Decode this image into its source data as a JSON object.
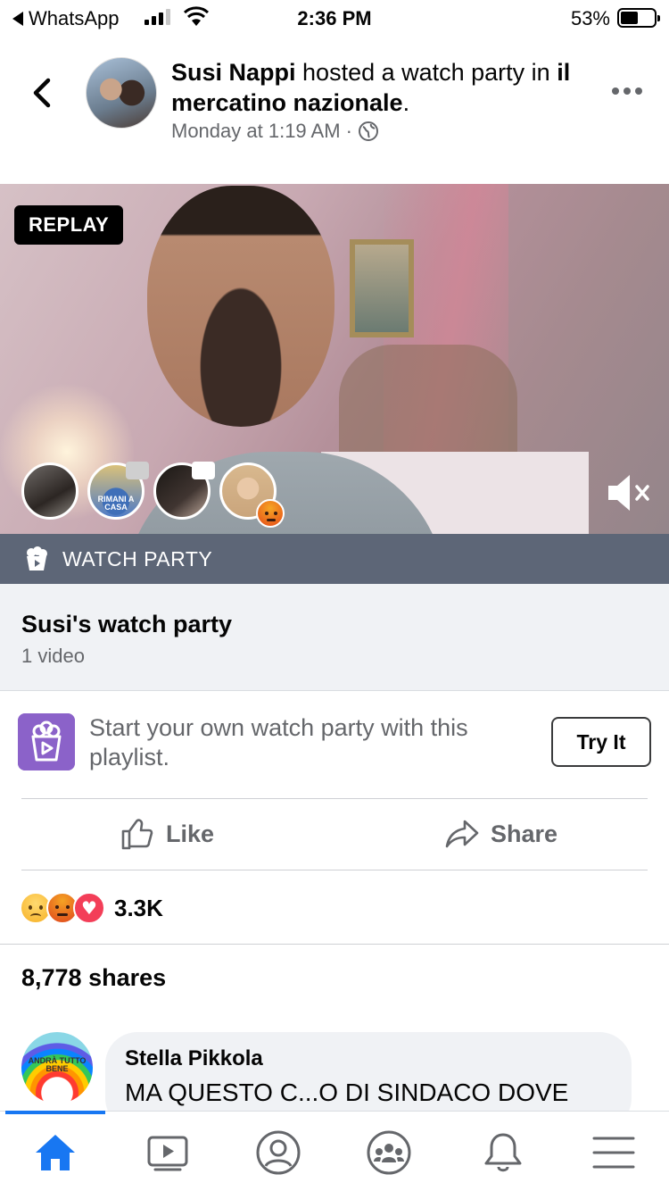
{
  "status_bar": {
    "back_app": "WhatsApp",
    "time": "2:36 PM",
    "battery_percent": "53%",
    "battery_level": 0.53,
    "signal_bars_active": 3
  },
  "post": {
    "author": "Susi Nappi",
    "action_text": " hosted a watch party in ",
    "group": "il mercatino nazionale",
    "period": ".",
    "timestamp": "Monday at 1:19 AM",
    "separator": "·",
    "privacy_icon": "globe-icon"
  },
  "video": {
    "badge": "REPLAY",
    "viewer_avatar_2_text": "RIMANI A CASA",
    "muted": true
  },
  "watch_party_bar": {
    "label": "WATCH PARTY"
  },
  "playlist": {
    "title": "Susi's watch party",
    "count": "1 video"
  },
  "promo": {
    "text": "Start your own watch party with this playlist.",
    "button": "Try It"
  },
  "actions": {
    "like": "Like",
    "share": "Share"
  },
  "reactions": {
    "types": [
      "sad",
      "angry",
      "love"
    ],
    "count": "3.3K"
  },
  "shares": "8,778 shares",
  "comment": {
    "avatar_text": "ANDRÀ TUTTO BENE",
    "author": "Stella Pikkola",
    "text": "MA QUESTO C...O DI SINDACO DOVE"
  },
  "tabbar": {
    "items": [
      "home-icon",
      "watch-icon",
      "profile-icon",
      "groups-icon",
      "notifications-icon",
      "menu-icon"
    ],
    "active": "home-icon",
    "accent": "#1877f2"
  },
  "colors": {
    "watch_party_bar": "#5d6677",
    "promo_icon": "#8b62c9",
    "secondary_text": "#65676b"
  }
}
